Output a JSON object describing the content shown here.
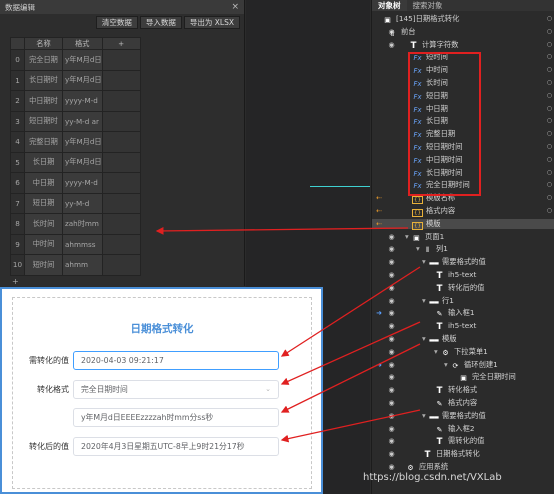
{
  "editor": {
    "title": "数据编辑",
    "close": "×",
    "buttons": [
      "清空数据",
      "导入数据",
      "导出为 XLSX"
    ],
    "columns": [
      "名称",
      "格式",
      "+"
    ],
    "rows": [
      {
        "n": "0",
        "name": "完全日期",
        "fmt": "y年M月d日"
      },
      {
        "n": "1",
        "name": "长日期时",
        "fmt": "y年M月d日"
      },
      {
        "n": "2",
        "name": "中日期时",
        "fmt": "yyyy-M-d"
      },
      {
        "n": "3",
        "name": "短日期时",
        "fmt": "yy-M-d ar"
      },
      {
        "n": "4",
        "name": "完整日期",
        "fmt": "y年M月d日"
      },
      {
        "n": "5",
        "name": "长日期",
        "fmt": "y年M月d日"
      },
      {
        "n": "6",
        "name": "中日期",
        "fmt": "yyyy-M-d"
      },
      {
        "n": "7",
        "name": "短日期",
        "fmt": "yy-M-d"
      },
      {
        "n": "8",
        "name": "长时间",
        "fmt": "zah时mm"
      },
      {
        "n": "9",
        "name": "中时间",
        "fmt": "ahmmss"
      },
      {
        "n": "10",
        "name": "短时间",
        "fmt": "ahmm"
      }
    ],
    "add_row": "+"
  },
  "preview": {
    "title": "日期格式转化",
    "fields": [
      {
        "label": "需转化的值",
        "value": "2020-04-03 09:21:17"
      },
      {
        "label": "转化格式",
        "value": "完全日期时间",
        "caret": "⌄"
      },
      {
        "label": "",
        "value": "y年M月d日EEEEzzzzah时mm分ss秒"
      },
      {
        "label": "转化后的值",
        "value": "2020年4月3日星期五UTC-8早上9时21分17秒"
      }
    ]
  },
  "tree": {
    "tabs": [
      "对象树",
      "搜索对象"
    ],
    "rows": [
      {
        "text": "[145]日期格式转化",
        "icon": "page",
        "indent": 10
      },
      {
        "text": "前台",
        "icon": "device",
        "indent": 15
      },
      {
        "text": "计算字符数",
        "icon": "T",
        "indent": 36
      },
      {
        "text": "短时间",
        "icon": "Fx",
        "indent": 40
      },
      {
        "text": "中时间",
        "icon": "Fx",
        "indent": 40
      },
      {
        "text": "长时间",
        "icon": "Fx",
        "indent": 40
      },
      {
        "text": "短日期",
        "icon": "Fx",
        "indent": 40
      },
      {
        "text": "中日期",
        "icon": "Fx",
        "indent": 40
      },
      {
        "text": "长日期",
        "icon": "Fx",
        "indent": 40
      },
      {
        "text": "完整日期",
        "icon": "Fx",
        "indent": 40
      },
      {
        "text": "短日期时间",
        "icon": "Fx",
        "indent": 40
      },
      {
        "text": "中日期时间",
        "icon": "Fx",
        "indent": 40
      },
      {
        "text": "长日期时间",
        "icon": "Fx",
        "indent": 40
      },
      {
        "text": "完全日期时间",
        "icon": "Fx",
        "indent": 40
      },
      {
        "text": "模版名称",
        "icon": "Y",
        "indent": 40
      },
      {
        "text": "格式内容",
        "icon": "Y",
        "indent": 40
      },
      {
        "text": "模版",
        "icon": "Y",
        "indent": 40
      },
      {
        "text": "页面1",
        "icon": "page",
        "indent": 33
      },
      {
        "text": "列1",
        "icon": "col",
        "indent": 44
      },
      {
        "text": "需要格式的值",
        "icon": "bar",
        "indent": 50
      },
      {
        "text": "ih5-text",
        "icon": "T",
        "indent": 62
      },
      {
        "text": "转化后的值",
        "icon": "T",
        "indent": 62
      },
      {
        "text": "行1",
        "icon": "bar",
        "indent": 50
      },
      {
        "text": "输入框1",
        "icon": "edit",
        "indent": 62
      },
      {
        "text": "ih5-text",
        "icon": "T",
        "indent": 62
      },
      {
        "text": "模版",
        "icon": "bar",
        "indent": 50
      },
      {
        "text": "下拉菜单1",
        "icon": "gear",
        "indent": 62
      },
      {
        "text": "循环创建1",
        "icon": "loop",
        "indent": 72
      },
      {
        "text": "完全日期时间",
        "icon": "frame",
        "indent": 86
      },
      {
        "text": "转化格式",
        "icon": "T",
        "indent": 62
      },
      {
        "text": "格式内容",
        "icon": "edit",
        "indent": 62
      },
      {
        "text": "需要格式的值",
        "icon": "bar",
        "indent": 50
      },
      {
        "text": "输入框2",
        "icon": "edit",
        "indent": 62
      },
      {
        "text": "需转化的值",
        "icon": "T",
        "indent": 62
      },
      {
        "text": "日期格式转化",
        "icon": "T",
        "indent": 50
      },
      {
        "text": "应用系统",
        "icon": "gear",
        "indent": 33
      }
    ]
  },
  "watermark": "https://blog.csdn.net/VXLab"
}
